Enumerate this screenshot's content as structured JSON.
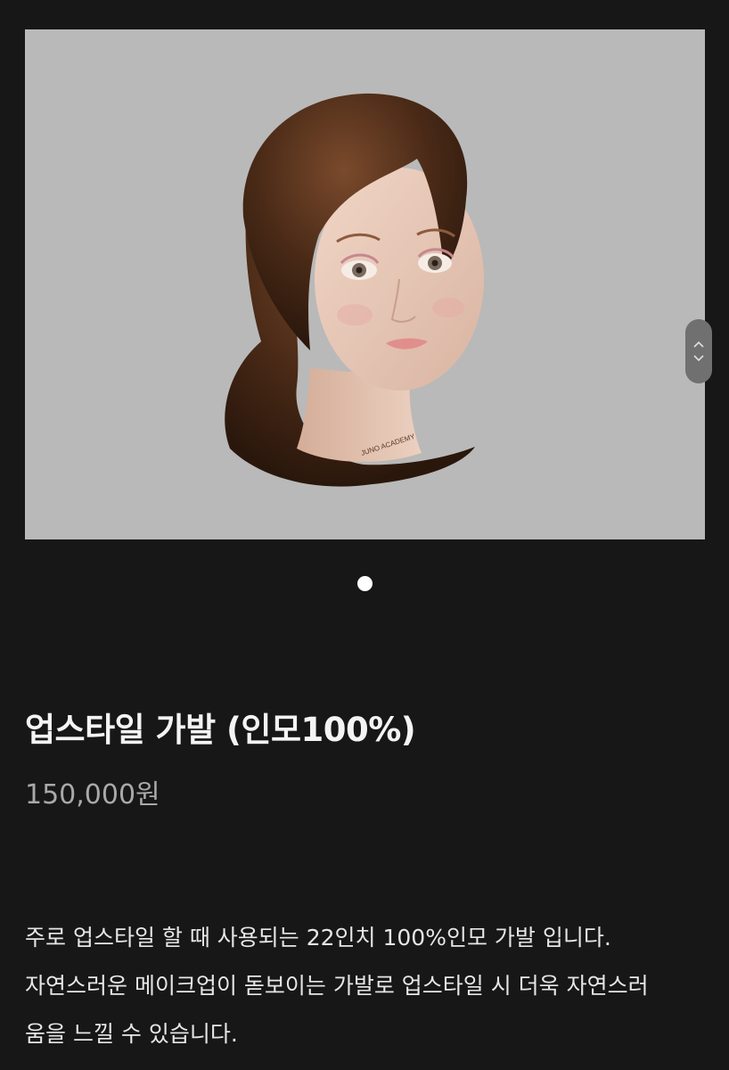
{
  "product": {
    "image_alt": "mannequin-head-with-hair",
    "mannequin_brand": "JUNO ACADEMY",
    "title": "업스타일 가발 (인모100%)",
    "price": "150,000원",
    "description_lines": [
      "주로 업스타일 할 때 사용되는 22인치 100%인모 가발 입니다.",
      "자연스러운 메이크업이 돋보이는 가발로 업스타일 시 더욱 자연스러",
      "움을 느낄 수 있습니다."
    ]
  },
  "carousel": {
    "dot_count": 1,
    "active_index": 0
  },
  "colors": {
    "background": "#171717",
    "image_background": "#b9b9b9",
    "price": "#a9a9a9"
  },
  "icons": {
    "scroll_up": "chevron-up-icon",
    "scroll_down": "chevron-down-icon"
  }
}
